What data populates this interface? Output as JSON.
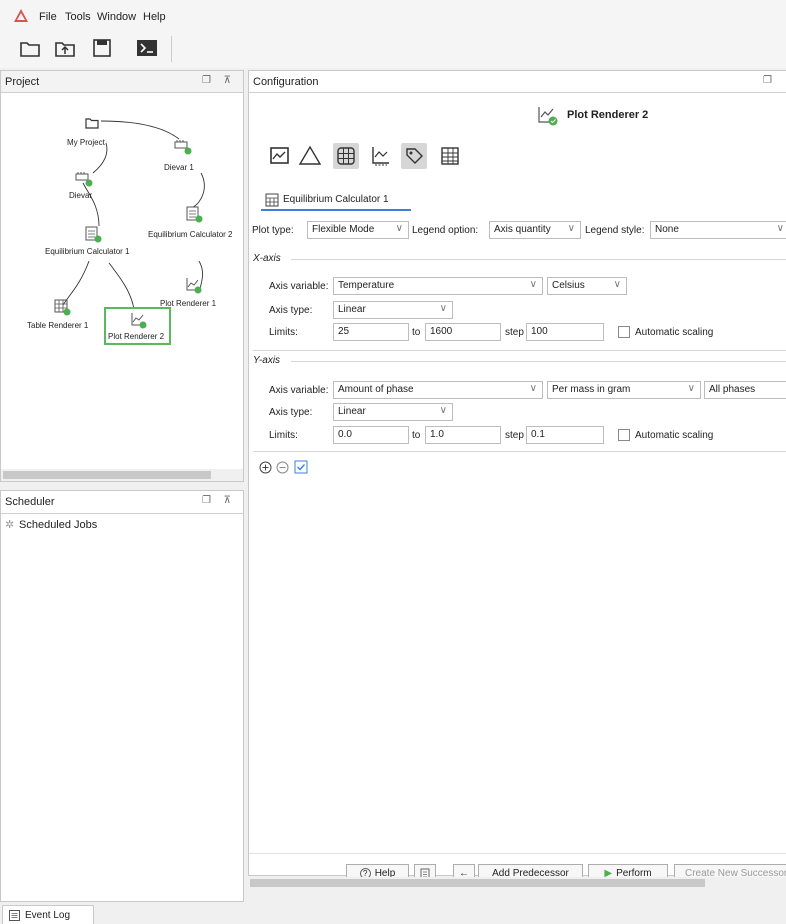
{
  "menu": [
    "File",
    "Tools",
    "Window",
    "Help"
  ],
  "toolbar": {
    "icons": [
      "folder-icon",
      "open-folder-icon",
      "save-icon",
      "console-icon"
    ]
  },
  "project": {
    "title": "Project",
    "nodes": {
      "my_project": "My Project",
      "dievar1": "Dievar 1",
      "dievar": "Dievar",
      "eq2": "Equilibrium Calculator 2",
      "eq1": "Equilibrium Calculator 1",
      "plot1": "Plot Renderer 1",
      "table1": "Table Renderer 1",
      "plot2": "Plot Renderer 2"
    }
  },
  "scheduler": {
    "title": "Scheduler",
    "item": "Scheduled Jobs"
  },
  "config": {
    "title": "Configuration",
    "node_title": "Plot Renderer 2",
    "tab": "Equilibrium Calculator 1",
    "plot_type_label": "Plot type:",
    "plot_type": "Flexible Mode",
    "legend_option_label": "Legend option:",
    "legend_option": "Axis quantity",
    "legend_style_label": "Legend style:",
    "legend_style": "None",
    "x_axis": {
      "title": "X-axis",
      "axis_variable_label": "Axis variable:",
      "variable": "Temperature",
      "unit": "Celsius",
      "axis_type_label": "Axis type:",
      "type": "Linear",
      "limits_label": "Limits:",
      "from": "25",
      "to_label": "to",
      "to": "1600",
      "step_label": "step",
      "step": "100",
      "auto_label": "Automatic scaling"
    },
    "y_axis": {
      "title": "Y-axis",
      "axis_variable_label": "Axis variable:",
      "variable": "Amount of phase",
      "unit": "Per mass in gram",
      "phases": "All phases",
      "axis_type_label": "Axis type:",
      "type": "Linear",
      "limits_label": "Limits:",
      "from": "0.0",
      "to_label": "to",
      "to": "1.0",
      "step_label": "step",
      "step": "0.1",
      "auto_label": "Automatic scaling"
    },
    "buttons": {
      "help": "Help",
      "add_predecessor": "Add Predecessor",
      "perform": "Perform",
      "create_successor": "Create New Successor"
    }
  },
  "event_log": "Event Log",
  "colors": {
    "accent_green": "#4caf50",
    "selection_border": "#5cb85c",
    "tab_underline": "#3c7fd6",
    "logo_red": "#d9534f"
  }
}
